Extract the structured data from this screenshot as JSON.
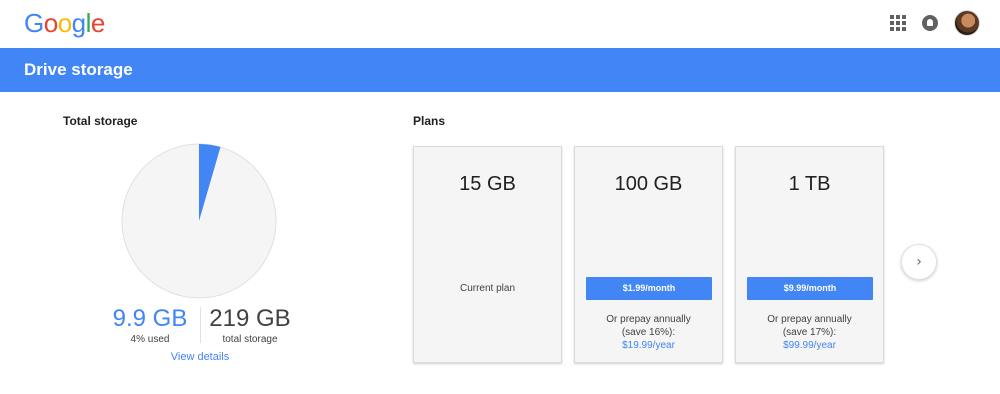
{
  "topbar": {
    "logo_letters": [
      {
        "ch": "G",
        "color": "#4285f4"
      },
      {
        "ch": "o",
        "color": "#ea4335"
      },
      {
        "ch": "o",
        "color": "#fbbc05"
      },
      {
        "ch": "g",
        "color": "#4285f4"
      },
      {
        "ch": "l",
        "color": "#34a853"
      },
      {
        "ch": "e",
        "color": "#ea4335"
      }
    ],
    "icons": [
      "apps-grid-icon",
      "notifications-icon",
      "account-avatar"
    ]
  },
  "header": {
    "title": "Drive storage",
    "color": "#4285f4"
  },
  "total_storage": {
    "section_title": "Total storage",
    "used_value": "9.9 GB",
    "used_label": "4% used",
    "used_fraction": 0.045,
    "total_value": "219 GB",
    "total_label": "total storage",
    "view_details": "View details",
    "used_color": "#4285f4",
    "free_color": "#f5f5f5"
  },
  "plans": {
    "section_title": "Plans",
    "items": [
      {
        "size": "15 GB",
        "current_label": "Current plan"
      },
      {
        "size": "100 GB",
        "price_button": "$1.99/month",
        "alt_line1": "Or prepay annually",
        "alt_line2": "(save 16%):",
        "alt_price": "$19.99/year"
      },
      {
        "size": "1 TB",
        "price_button": "$9.99/month",
        "alt_line1": "Or prepay annually",
        "alt_line2": "(save 17%):",
        "alt_price": "$99.99/year"
      }
    ],
    "next_icon": "chevron-right-icon",
    "next_glyph": "›"
  }
}
